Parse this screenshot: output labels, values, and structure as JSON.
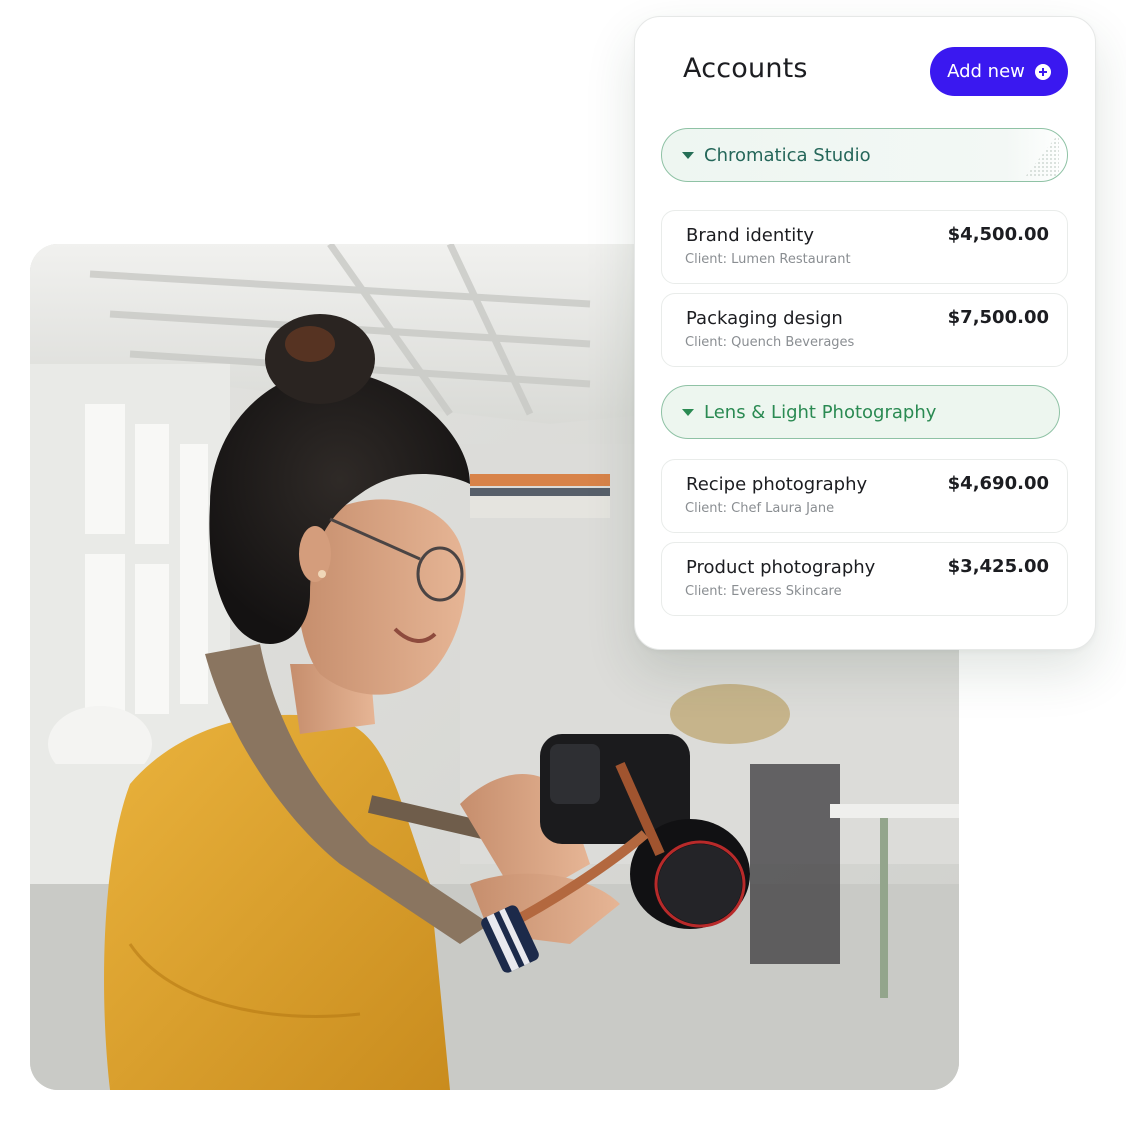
{
  "accounts": {
    "title": "Accounts",
    "add_button_label": "Add new",
    "groups": [
      {
        "name": "Chromatica Studio",
        "items": [
          {
            "name": "Brand identity",
            "client": "Client: Lumen Restaurant",
            "amount": "$4,500.00"
          },
          {
            "name": "Packaging design",
            "client": "Client: Quench Beverages",
            "amount": "$7,500.00"
          }
        ]
      },
      {
        "name": "Lens & Light Photography",
        "items": [
          {
            "name": "Recipe photography",
            "client": "Client: Chef Laura Jane",
            "amount": "$4,690.00"
          },
          {
            "name": "Product photography",
            "client": "Client: Everess Skincare",
            "amount": "$3,425.00"
          }
        ]
      }
    ]
  },
  "colors": {
    "primary_button": "#3a18f0",
    "group_border": "#8fc2a5",
    "group_text": "#25675a",
    "shirt": "#e4a531"
  }
}
